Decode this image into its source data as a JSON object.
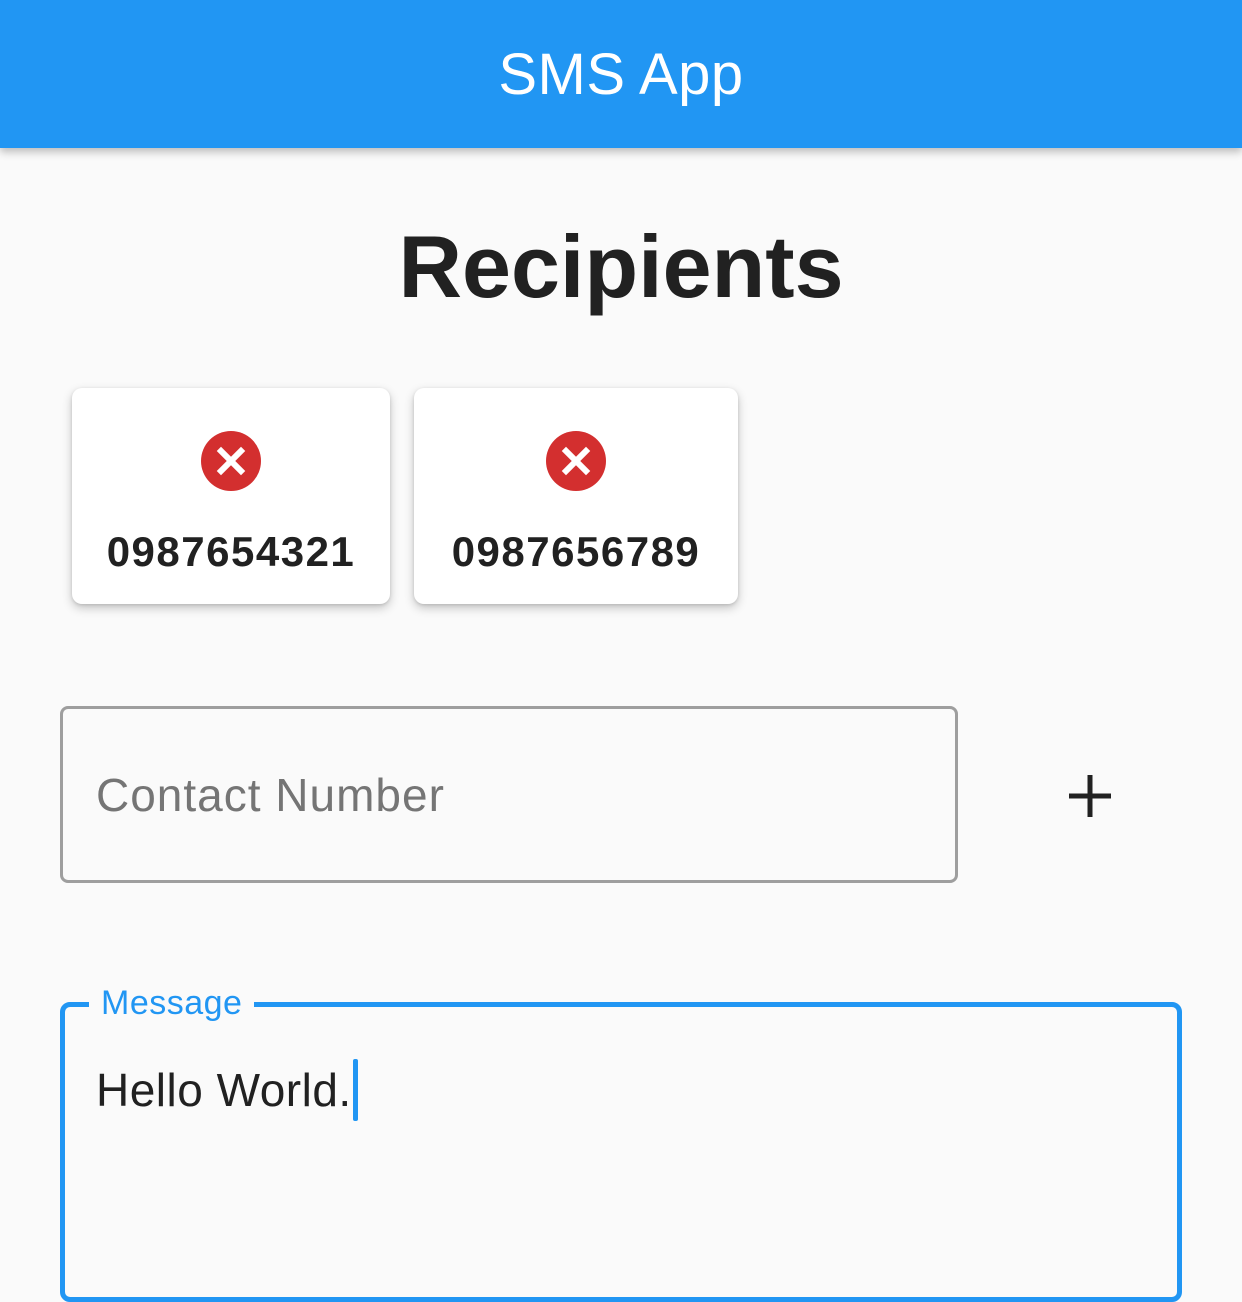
{
  "app_bar": {
    "title": "SMS App",
    "color": "#2196f3"
  },
  "recipients": {
    "title": "Recipients",
    "items": [
      {
        "number": "0987654321",
        "remove_icon": "cancel-circle-icon"
      },
      {
        "number": "0987656789",
        "remove_icon": "cancel-circle-icon"
      }
    ]
  },
  "contact_input": {
    "placeholder": "Contact Number",
    "value": ""
  },
  "add_button": {
    "icon": "plus-icon"
  },
  "message_input": {
    "label": "Message",
    "value": "Hello World.",
    "accent_color": "#2196f3"
  },
  "colors": {
    "remove_icon": "#d32f2f",
    "background": "#fafafa"
  }
}
